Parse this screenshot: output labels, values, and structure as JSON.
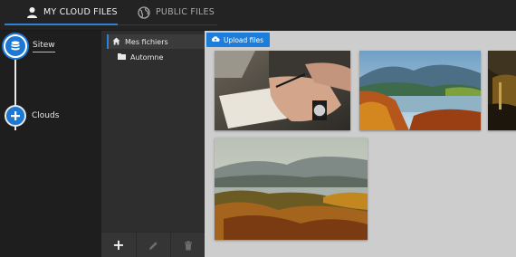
{
  "tabs": {
    "my_cloud_files": "MY CLOUD FILES",
    "public_files": "PUBLIC FILES"
  },
  "clouds": {
    "items": [
      {
        "label": "Sitew",
        "icon": "database-icon"
      },
      {
        "label": "Clouds",
        "icon": "plus-icon"
      }
    ]
  },
  "folders": {
    "items": [
      {
        "label": "Mes fichiers",
        "icon": "home-icon"
      },
      {
        "label": "Automne",
        "icon": "folder-icon"
      }
    ],
    "toolbar": {
      "add": "+",
      "icons": [
        "pencil-icon",
        "trash-icon"
      ]
    }
  },
  "gallery": {
    "upload_label": "Upload files",
    "images": [
      {
        "subject": "person writing in notebook with wristwatch"
      },
      {
        "subject": "autumn lake with mountains"
      },
      {
        "subject": "dark autumn forest (partially visible)"
      },
      {
        "subject": "misty autumn lake landscape"
      }
    ]
  },
  "colors": {
    "accent": "#1d78d3",
    "panel_dark": "#1e1e1e",
    "panel_mid": "#2e2e2e",
    "gallery_bg": "#cdcdcd"
  }
}
